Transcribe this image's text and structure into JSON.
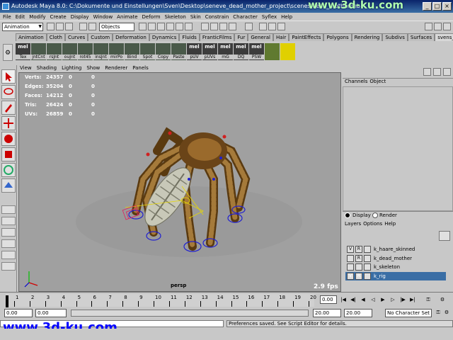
{
  "title_bar": {
    "title": "Autodesk Maya 8.0: C:\\Dokumente und Einstellungen\\Sven\\Desktop\\seneve_dead_mother_project\\scenes\\dead_mother.mb",
    "watermark": "www.3d-ku.com"
  },
  "menu_bar": [
    "File",
    "Edit",
    "Modify",
    "Create",
    "Display",
    "Window",
    "Animate",
    "Deform",
    "Skeleton",
    "Skin",
    "Constrain",
    "Character",
    "Syflex",
    "Help"
  ],
  "status_line": {
    "mode": "Animation",
    "object_field": "Objects"
  },
  "shelf_tabs": [
    "Animation",
    "Cloth",
    "Curves",
    "Custom",
    "Deformation",
    "Dynamics",
    "Fluids",
    "FranticFilms",
    "Fur",
    "General",
    "Hair",
    "PaintEffects",
    "Polygons",
    "Rendering",
    "Subdivs",
    "Surfaces",
    "svens_regal"
  ],
  "active_shelf_tab": "svens_regal",
  "shelf_buttons": [
    {
      "top": "mel",
      "bottom": "Tex"
    },
    {
      "top": "",
      "bottom": "jntCnt"
    },
    {
      "top": "",
      "bottom": "rsJnt"
    },
    {
      "top": "",
      "bottom": "ouJnt"
    },
    {
      "top": "",
      "bottom": "rot45"
    },
    {
      "top": "",
      "bottom": "insJnt"
    },
    {
      "top": "",
      "bottom": "mirPo"
    },
    {
      "top": "",
      "bottom": "Bind"
    },
    {
      "top": "",
      "bottom": "Spot"
    },
    {
      "top": "",
      "bottom": "Copy"
    },
    {
      "top": "",
      "bottom": "Paste"
    },
    {
      "top": "mel",
      "bottom": "pUV"
    },
    {
      "top": "mel",
      "bottom": "pUVs"
    },
    {
      "top": "mel",
      "bottom": "mG"
    },
    {
      "top": "mel",
      "bottom": "DQ"
    },
    {
      "top": "mel",
      "bottom": "PSW"
    }
  ],
  "viewport": {
    "menu": [
      "View",
      "Shading",
      "Lighting",
      "Show",
      "Renderer",
      "Panels"
    ],
    "hud": [
      {
        "label": "Verts:",
        "v1": "24357",
        "v2": "0",
        "v3": "0"
      },
      {
        "label": "Edges:",
        "v1": "35204",
        "v2": "0",
        "v3": "0"
      },
      {
        "label": "Faces:",
        "v1": "14212",
        "v2": "0",
        "v3": "0"
      },
      {
        "label": "Tris:",
        "v1": "26424",
        "v2": "0",
        "v3": "0"
      },
      {
        "label": "UVs:",
        "v1": "26859",
        "v2": "0",
        "v3": "0"
      }
    ],
    "camera": "persp",
    "fps": "2.9 fps"
  },
  "channel_box": {
    "menu": [
      "Channels",
      "Object"
    ]
  },
  "layer_editor": {
    "display_label": "Display",
    "render_label": "Render",
    "menu": [
      "Layers",
      "Options",
      "Help"
    ],
    "layers": [
      {
        "v": "V",
        "r": "R",
        "name": "k_haare_skinned",
        "selected": false
      },
      {
        "v": "",
        "r": "R",
        "name": "k_dead_mother",
        "selected": false
      },
      {
        "v": "",
        "r": "",
        "name": "k_skeleton",
        "selected": false
      },
      {
        "v": "V",
        "r": "R",
        "name": "k_rig",
        "selected": true
      }
    ]
  },
  "timeline": {
    "ticks": [
      "1",
      "2",
      "3",
      "4",
      "5",
      "6",
      "7",
      "8",
      "9",
      "10",
      "11",
      "12",
      "13",
      "14",
      "15",
      "16",
      "17",
      "18",
      "19",
      "20"
    ],
    "current_time": "0.00"
  },
  "range_slider": {
    "start": "0.00",
    "playback_start": "0.00",
    "playback_end": "20.00",
    "end": "20.00",
    "character_set": "No Character Set"
  },
  "command_line": {
    "result": "Preferences saved. See Script Editor for details."
  },
  "big_watermark": "www.3d-ku.com"
}
